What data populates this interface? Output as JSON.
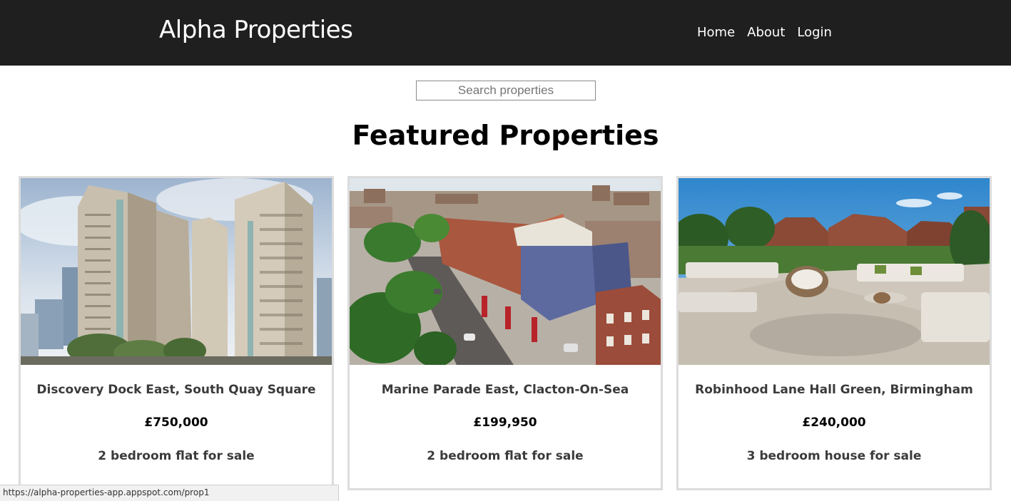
{
  "header": {
    "brand": "Alpha Properties",
    "nav": [
      "Home",
      "About",
      "Login"
    ]
  },
  "search": {
    "placeholder": "Search properties",
    "value": ""
  },
  "heading": "Featured Properties",
  "properties": [
    {
      "title": "Discovery Dock East, South Quay Square",
      "price": "£750,000",
      "description": "2 bedroom flat for sale",
      "image": "tower-block-photo"
    },
    {
      "title": "Marine Parade East, Clacton-On-Sea",
      "price": "£199,950",
      "description": "2 bedroom flat for sale",
      "image": "apartment-street-aerial-photo"
    },
    {
      "title": "Robinhood Lane Hall Green, Birmingham",
      "price": "£240,000",
      "description": "3 bedroom house for sale",
      "image": "roof-terrace-photo"
    }
  ],
  "status_bar": {
    "url": "https://alpha-properties-app.appspot.com/prop1"
  },
  "colors": {
    "header_bg": "#1f1f1f",
    "card_border": "#dcdcdc",
    "text_dark": "#3b3b3b"
  }
}
